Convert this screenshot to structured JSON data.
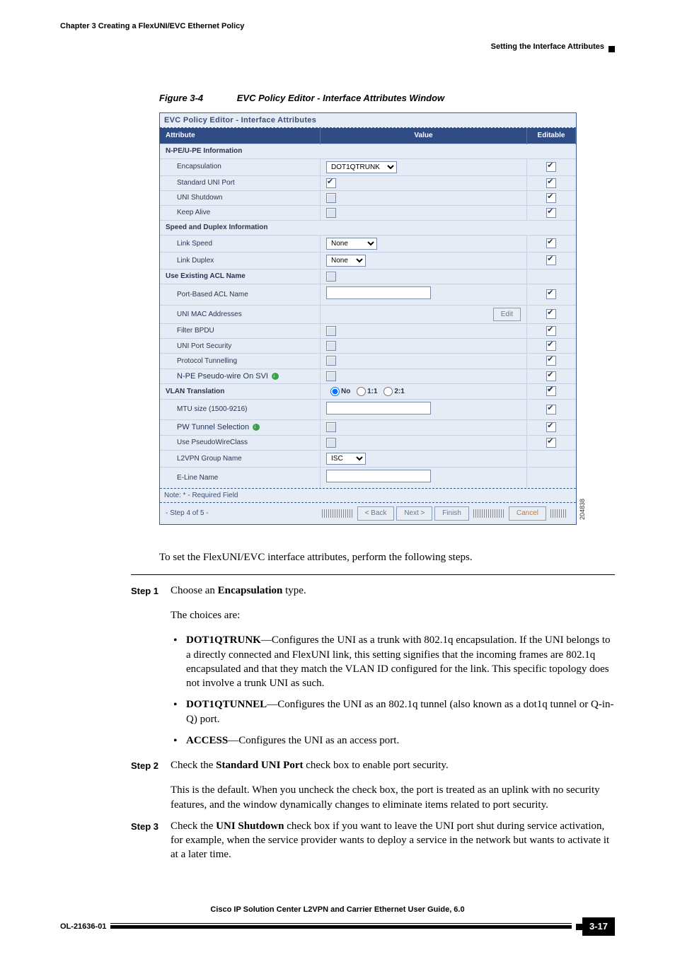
{
  "header": {
    "chapter_line": "Chapter 3      Creating a FlexUNI/EVC Ethernet Policy",
    "section_line": "Setting the Interface Attributes"
  },
  "figure": {
    "label": "Figure 3-4",
    "title": "EVC Policy Editor - Interface Attributes Window",
    "image_number": "204838"
  },
  "editor": {
    "title": "EVC Policy Editor - Interface Attributes",
    "cols": {
      "attr": "Attribute",
      "val": "Value",
      "ed": "Editable"
    },
    "rows": {
      "sec1": "N-PE/U-PE Information",
      "encap": "Encapsulation",
      "encap_opts": [
        "DOT1QTRUNK"
      ],
      "std_uni": "Standard UNI Port",
      "uni_shut": "UNI Shutdown",
      "keep": "Keep Alive",
      "sec2": "Speed and Duplex Information",
      "speed": "Link Speed",
      "speed_opts": [
        "None"
      ],
      "duplex": "Link Duplex",
      "duplex_opts": [
        "None"
      ],
      "useacl": "Use Existing ACL Name",
      "pbacl": "Port-Based ACL Name",
      "unimac": "UNI MAC Addresses",
      "edit_btn": "Edit",
      "fbpdu": "Filter BPDU",
      "ups": "UNI Port Security",
      "ptun": "Protocol Tunnelling",
      "npesvi": "N-PE Pseudo-wire On SVI",
      "vlant": "VLAN Translation",
      "vlant_no": "No",
      "vlant_11": "1:1",
      "vlant_21": "2:1",
      "mtu": "MTU size (1500-9216)",
      "pwtun": "PW Tunnel Selection",
      "usepwc": "Use PseudoWireClass",
      "l2vpn": "L2VPN Group Name",
      "l2vpn_opts": [
        "ISC"
      ],
      "eline": "E-Line Name"
    },
    "note": "Note: * - Required Field",
    "step": "- Step 4 of 5 -",
    "btns": {
      "back": "< Back",
      "next": "Next >",
      "finish": "Finish",
      "cancel": "Cancel"
    }
  },
  "text": {
    "intro": "To set the FlexUNI/EVC interface attributes, perform the following steps.",
    "step1_lbl": "Step 1",
    "step1_a": "Choose an ",
    "step1_b": "Encapsulation",
    "step1_c": " type.",
    "step1_choices": "The choices are:",
    "b1_a": "DOT1QTRUNK",
    "b1_b": "—Configures the UNI as a trunk with 802.1q encapsulation. If the UNI belongs to a directly connected and FlexUNI link, this setting signifies that the incoming frames are 802.1q encapsulated and that they match the VLAN ID configured for the link. This specific topology does not involve a trunk UNI as such.",
    "b2_a": "DOT1QTUNNEL",
    "b2_b": "—Configures the UNI as an 802.1q tunnel (also known as a dot1q tunnel or Q-in-Q) port.",
    "b3_a": "ACCESS",
    "b3_b": "—Configures the UNI as an access port.",
    "step2_lbl": "Step 2",
    "step2_a": "Check the ",
    "step2_b": "Standard UNI Port",
    "step2_c": " check box to enable port security.",
    "step2_p": "This is the default. When you uncheck the check box, the port is treated as an uplink with no security features, and the window dynamically changes to eliminate items related to port security.",
    "step3_lbl": "Step 3",
    "step3_a": "Check the ",
    "step3_b": "UNI Shutdown",
    "step3_c": " check box if you want to leave the UNI port shut during service activation, for example, when the service provider wants to deploy a service in the network but wants to activate it at a later time."
  },
  "footer": {
    "title": "Cisco IP Solution Center L2VPN and Carrier Ethernet User Guide, 6.0",
    "doc": "OL-21636-01",
    "page": "3-17"
  }
}
